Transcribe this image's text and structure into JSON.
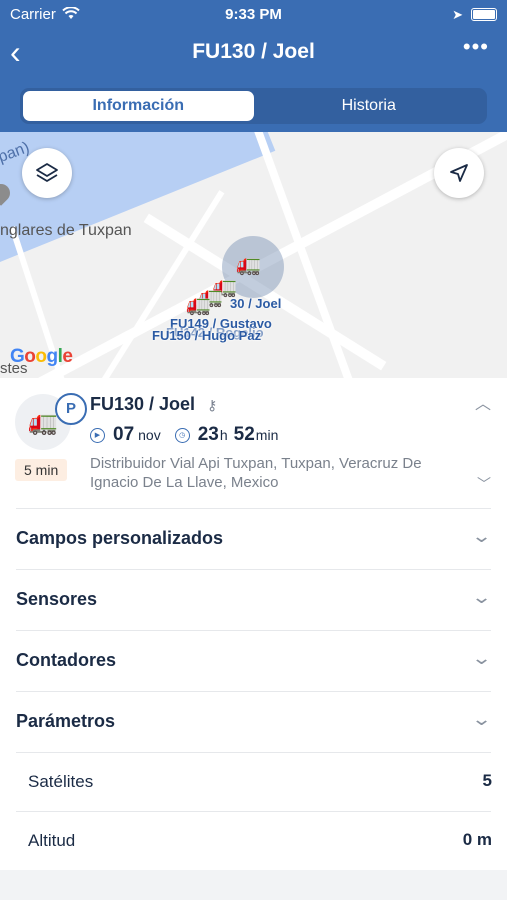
{
  "status_bar": {
    "carrier": "Carrier",
    "time": "9:33 PM"
  },
  "nav": {
    "title": "FU130 / Joel",
    "more": "•••"
  },
  "tabs": [
    {
      "label": "Información",
      "active": true
    },
    {
      "label": "Historia",
      "active": false
    }
  ],
  "map": {
    "place_label": "nglares de Tuxpan",
    "edge_label_top": "pan)",
    "edge_label_bottom": "stes",
    "units": [
      {
        "label": "30 / Joel"
      },
      {
        "label": "FU149 / Gustavo"
      },
      {
        "label": "FU150 / Hugo Paz"
      },
      {
        "label": "FU142 / Rogelio"
      }
    ],
    "google": [
      "G",
      "o",
      "o",
      "g",
      "l",
      "e"
    ]
  },
  "unit": {
    "name": "FU130 / Joel",
    "badge": "P",
    "age": "5 min",
    "date_day": "07",
    "date_month": "nov",
    "duration_h": "23",
    "duration_h_unit": "h",
    "duration_m": "52",
    "duration_m_unit": "min",
    "address": "Distribuidor Vial Api Tuxpan, Tuxpan, Veracruz De Ignacio De La Llave, Mexico"
  },
  "sections": [
    {
      "label": "Campos personalizados"
    },
    {
      "label": "Sensores"
    },
    {
      "label": "Contadores"
    },
    {
      "label": "Parámetros"
    }
  ],
  "parameters": [
    {
      "label": "Satélites",
      "value": "5"
    },
    {
      "label": "Altitud",
      "value": "0 m"
    }
  ],
  "colors": {
    "header": "#3a6db3",
    "accent": "#3a6db3",
    "age_badge_bg": "#fdeee2"
  }
}
